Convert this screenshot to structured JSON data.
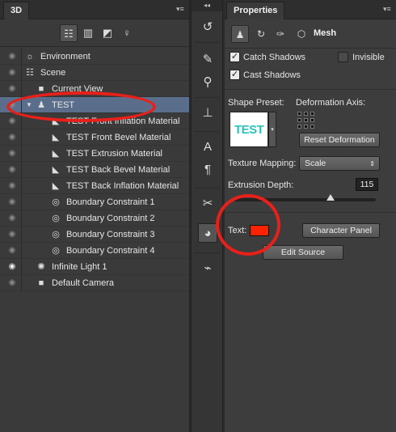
{
  "panel3d": {
    "tab": "3D",
    "filters": [
      "whole-scene-icon",
      "meshes-icon",
      "materials-icon",
      "lights-icon"
    ],
    "layers": [
      {
        "label": "Environment",
        "icon": "sun-icon",
        "indent": 1,
        "eye": true
      },
      {
        "label": "Scene",
        "icon": "scene-icon",
        "indent": 1,
        "eye": true
      },
      {
        "label": "Current View",
        "icon": "camera-icon",
        "indent": 2,
        "eye": true
      },
      {
        "label": "TEST",
        "icon": "mesh-icon",
        "indent": 1,
        "eye": true,
        "selected": true,
        "expanded": true
      },
      {
        "label": "TEST Front Inflation Material",
        "icon": "material-icon",
        "indent": 3,
        "eye": true
      },
      {
        "label": "TEST Front Bevel Material",
        "icon": "material-icon",
        "indent": 3,
        "eye": true
      },
      {
        "label": "TEST Extrusion Material",
        "icon": "material-icon",
        "indent": 3,
        "eye": true
      },
      {
        "label": "TEST Back Bevel Material",
        "icon": "material-icon",
        "indent": 3,
        "eye": true
      },
      {
        "label": "TEST Back Inflation Material",
        "icon": "material-icon",
        "indent": 3,
        "eye": true
      },
      {
        "label": "Boundary Constraint 1",
        "icon": "constraint-icon",
        "indent": 3,
        "eye": true
      },
      {
        "label": "Boundary Constraint 2",
        "icon": "constraint-icon",
        "indent": 3,
        "eye": true
      },
      {
        "label": "Boundary Constraint 3",
        "icon": "constraint-icon",
        "indent": 3,
        "eye": true
      },
      {
        "label": "Boundary Constraint 4",
        "icon": "constraint-icon",
        "indent": 3,
        "eye": true
      },
      {
        "label": "Infinite Light 1",
        "icon": "light-icon",
        "indent": 2,
        "eye": true,
        "eyeBright": true
      },
      {
        "label": "Default Camera",
        "icon": "camera-icon",
        "indent": 2,
        "eye": true
      }
    ]
  },
  "tools": [
    "history-icon",
    "brushes-icon",
    "brush-presets-icon",
    "clone-source-icon",
    "character-icon",
    "paragraph-icon",
    "tools-icon",
    "3d-icon",
    "path-icon"
  ],
  "properties": {
    "tab": "Properties",
    "mesh_label": "Mesh",
    "catch_shadows": "Catch Shadows",
    "invisible": "Invisible",
    "cast_shadows": "Cast Shadows",
    "shape_preset_label": "Shape Preset:",
    "preset_text": "TEST",
    "deformation_axis_label": "Deformation Axis:",
    "reset_deformation": "Reset Deformation",
    "texture_mapping_label": "Texture Mapping:",
    "texture_mapping_value": "Scale",
    "extrusion_depth_label": "Extrusion Depth:",
    "extrusion_depth_value": "115",
    "extrusion_depth_slider_fraction": 0.68,
    "text_label": "Text:",
    "text_color": "#ff2200",
    "character_panel": "Character Panel",
    "edit_source": "Edit Source"
  },
  "colors": {
    "accent": "#5a6e8c",
    "annotation": "#e8201a"
  }
}
